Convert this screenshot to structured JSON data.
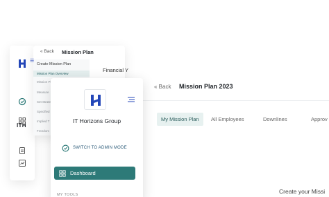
{
  "sidebar_bg": {
    "org_abbr": "ITH"
  },
  "back_panel": {
    "back_label": "Back",
    "title": "Mission Plan",
    "create_label": "Create Mission Plan",
    "items": [
      "Mission Plan Overview",
      "Mission Pla",
      "Measure",
      "Set Strate",
      "Specified",
      "Implied T",
      "Freedom"
    ],
    "financial_label": "Financial Y"
  },
  "main": {
    "back_label": "Back",
    "title": "Mission Plan 2023",
    "tabs": [
      {
        "label": "My Mission Plan",
        "active": true
      },
      {
        "label": "All Employees",
        "active": false
      },
      {
        "label": "Downlines",
        "active": false
      },
      {
        "label": "Approv",
        "active": false
      }
    ],
    "create_label": "Create your Missi"
  },
  "front_sidebar": {
    "org_name": "IT Horizons Group",
    "switch_label": "SWITCH TO ADMIN MODE",
    "dashboard_label": "Dashboard",
    "tools_label": "MY TOOLS"
  },
  "colors": {
    "accent": "#2d7a78",
    "logo_blue": "#2447b8",
    "tab_active_bg": "#e7f1f0"
  }
}
